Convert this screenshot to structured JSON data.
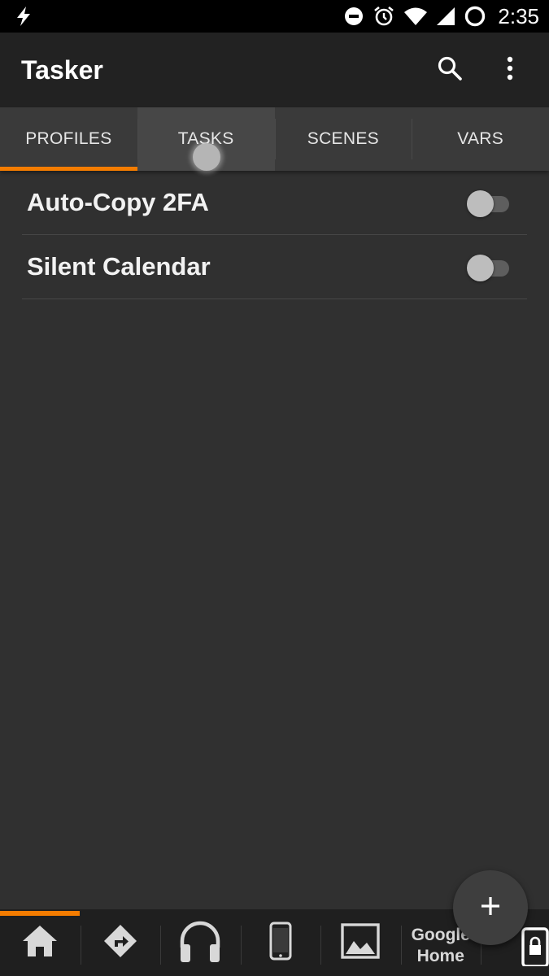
{
  "status_bar": {
    "time": "2:35",
    "icons": [
      "flash-icon",
      "do-not-disturb-icon",
      "alarm-icon",
      "wifi-icon",
      "cell-signal-icon",
      "battery-ring-icon"
    ]
  },
  "app_bar": {
    "title": "Tasker",
    "actions": [
      "search-icon",
      "overflow-menu-icon"
    ]
  },
  "tabs": [
    {
      "label": "PROFILES",
      "active": true
    },
    {
      "label": "TASKS",
      "active": false
    },
    {
      "label": "SCENES",
      "active": false
    },
    {
      "label": "VARS",
      "active": false
    }
  ],
  "profiles": [
    {
      "name": "Auto-Copy 2FA",
      "enabled": false
    },
    {
      "name": "Silent Calendar",
      "enabled": false
    }
  ],
  "fab": {
    "icon": "plus-icon"
  },
  "bottom_bar": {
    "items": [
      {
        "icon": "home-icon",
        "selected": true
      },
      {
        "icon": "directions-icon"
      },
      {
        "icon": "headphones-icon"
      },
      {
        "icon": "phone-icon"
      },
      {
        "icon": "image-icon"
      },
      {
        "label_line1": "Google",
        "label_line2": "Home"
      },
      {
        "icon": "lock-screen-icon"
      }
    ]
  },
  "colors": {
    "accent": "#f47c00",
    "app_bar": "#222222",
    "tabs": "#3a3a3a",
    "content": "#303030"
  }
}
